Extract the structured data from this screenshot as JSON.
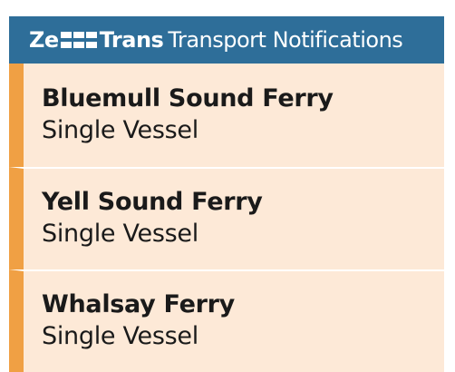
{
  "header": {
    "brand_prefix": "Ze",
    "brand_suffix": "Trans",
    "title": "Transport Notifications",
    "background_color": "#2e6e99",
    "logo_icon": "zettrans-logo-icon"
  },
  "notifications": [
    {
      "title": "Bluemull Sound Ferry",
      "status": "Single Vessel"
    },
    {
      "title": "Yell Sound Ferry",
      "status": "Single Vessel"
    },
    {
      "title": "Whalsay Ferry",
      "status": "Single Vessel"
    }
  ],
  "colors": {
    "item_background": "#fde9d7",
    "item_accent": "#f0a044"
  }
}
